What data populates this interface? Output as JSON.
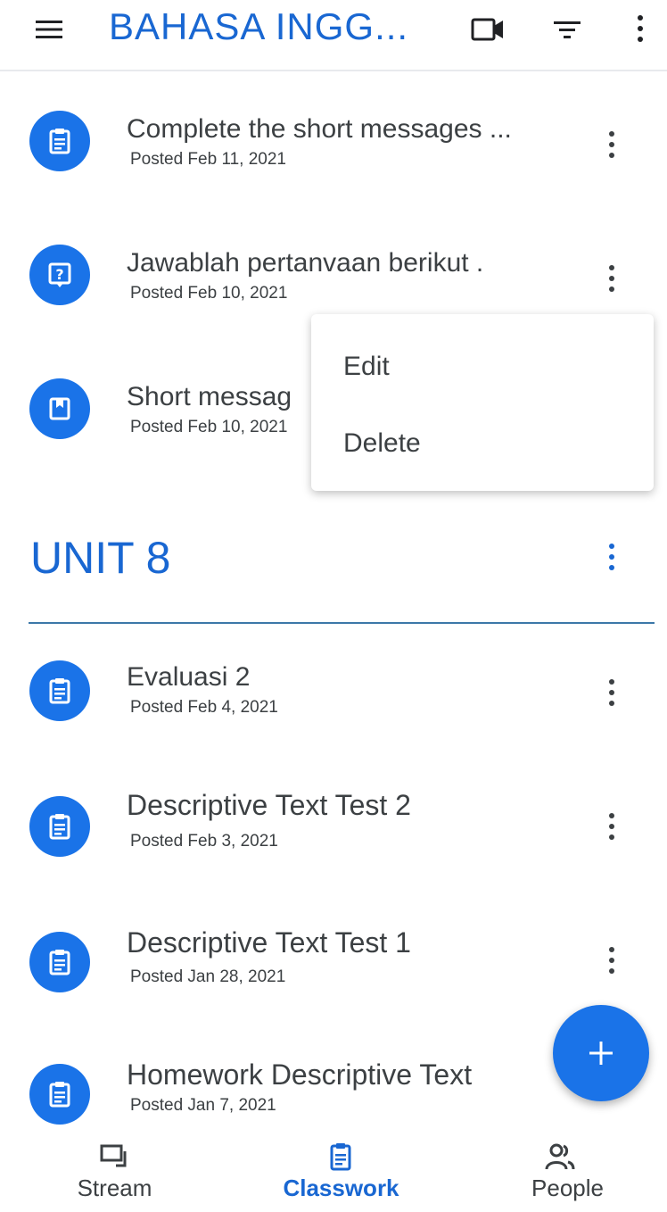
{
  "app": {
    "title": "BAHASA INGG...",
    "icons": {
      "menu": "hamburger-icon",
      "video": "video-camera-icon",
      "filter": "filter-icon",
      "more": "more-vert-icon"
    }
  },
  "colors": {
    "accent": "#1a73e8",
    "title": "#1967d2",
    "text": "#3c4043"
  },
  "items_top": [
    {
      "title": "Complete the short messages ...",
      "date": "Posted Feb 11, 2021",
      "icon": "assignment-icon"
    },
    {
      "title": "Jawablah pertanvaan berikut .",
      "date": "Posted Feb 10, 2021",
      "icon": "question-icon"
    },
    {
      "title": "Short messag",
      "date": "Posted Feb 10, 2021",
      "icon": "material-icon"
    }
  ],
  "context_menu": {
    "edit": "Edit",
    "delete": "Delete"
  },
  "section": {
    "title": "UNIT 8"
  },
  "items_unit": [
    {
      "title": "Evaluasi 2",
      "date": "Posted Feb 4, 2021",
      "icon": "assignment-icon"
    },
    {
      "title": "Descriptive Text Test 2",
      "date": "Posted Feb 3, 2021",
      "icon": "assignment-icon"
    },
    {
      "title": "Descriptive Text Test 1",
      "date": "Posted Jan 28, 2021",
      "icon": "assignment-icon"
    },
    {
      "title": "Homework Descriptive Text",
      "date": "Posted Jan 7, 2021",
      "icon": "assignment-icon"
    }
  ],
  "fab": {
    "icon": "plus-icon"
  },
  "bottom_nav": {
    "tabs": [
      {
        "label": "Stream",
        "icon": "stream-icon",
        "active": false
      },
      {
        "label": "Classwork",
        "icon": "classwork-icon",
        "active": true
      },
      {
        "label": "People",
        "icon": "people-icon",
        "active": false
      }
    ]
  }
}
